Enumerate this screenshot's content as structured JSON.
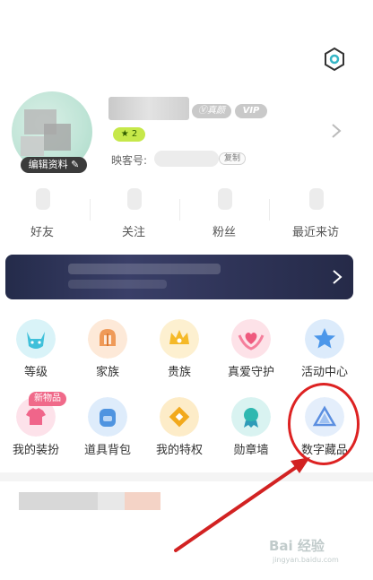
{
  "profile": {
    "edit_label": "编辑资料",
    "vip_v": "真颜",
    "vip_label": "VIP",
    "level": "2",
    "id_label": "映客号:",
    "copy_label": "复制"
  },
  "stats": [
    {
      "label": "好友"
    },
    {
      "label": "关注"
    },
    {
      "label": "粉丝"
    },
    {
      "label": "最近来访"
    }
  ],
  "grid": {
    "row1": [
      {
        "label": "等级",
        "icon": "cat-face-icon",
        "color": "#7fd6e8"
      },
      {
        "label": "家族",
        "icon": "helmet-icon",
        "color": "#f2b27d"
      },
      {
        "label": "贵族",
        "icon": "crown-icon",
        "color": "#f7cc5c"
      },
      {
        "label": "真爱守护",
        "icon": "heart-guard-icon",
        "color": "#f49fb0"
      },
      {
        "label": "活动中心",
        "icon": "star-icon",
        "color": "#7fb8f0"
      }
    ],
    "row2": [
      {
        "label": "我的装扮",
        "icon": "shirt-icon",
        "color": "#f49fb8"
      },
      {
        "label": "道具背包",
        "icon": "backpack-icon",
        "color": "#8fbfee"
      },
      {
        "label": "我的特权",
        "icon": "diamond-icon",
        "color": "#f4bf56"
      },
      {
        "label": "勋章墙",
        "icon": "medal-icon",
        "color": "#8fd9d2"
      },
      {
        "label": "数字藏品",
        "icon": "digital-collection-icon",
        "color": "#a9c8f2"
      }
    ],
    "new_tag": "新物品"
  },
  "watermark": {
    "text": "Bai 经验",
    "url": "jingyan.baidu.com"
  },
  "colors": {
    "annotation_red": "#d22222",
    "level_green": "#c6e84a"
  }
}
